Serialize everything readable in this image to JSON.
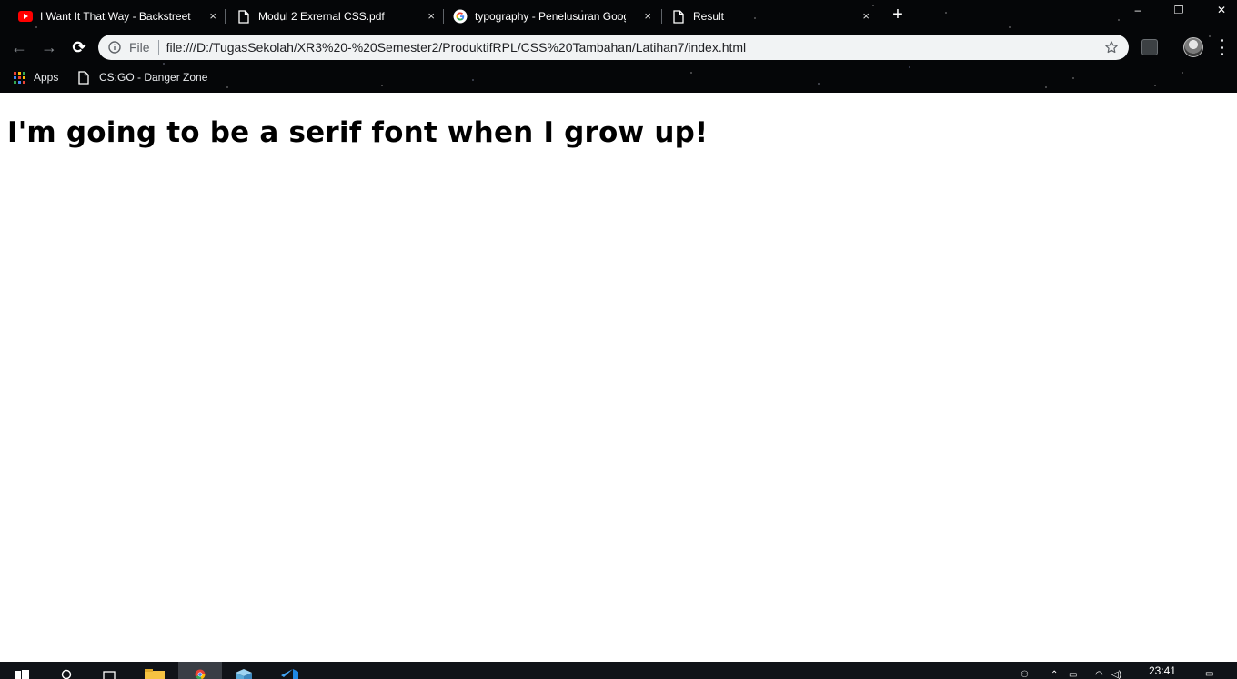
{
  "browser": {
    "tabs": [
      {
        "title": "I Want It That Way - Backstreet B",
        "icon": "youtube-icon",
        "close": "×"
      },
      {
        "title": "Modul 2 Exrernal CSS.pdf",
        "icon": "file-icon",
        "close": "×"
      },
      {
        "title": "typography - Penelusuran Googl",
        "icon": "google-icon",
        "close": "×"
      },
      {
        "title": "Result",
        "icon": "file-icon",
        "close": "×",
        "active": true
      }
    ],
    "new_tab_label": "+",
    "window_controls": {
      "minimize": "–",
      "restore": "❐",
      "close": "✕"
    },
    "toolbar": {
      "back": "←",
      "forward": "→",
      "reload": "⟳"
    },
    "omnibox": {
      "scheme_label": "File",
      "url": "file:///D:/TugasSekolah/XR3%20-%20Semester2/ProduktifRPL/CSS%20Tambahan/Latihan7/index.html"
    },
    "bookmarks": [
      {
        "label": "Apps",
        "icon": "apps-grid-icon"
      },
      {
        "label": "CS:GO - Danger Zone",
        "icon": "file-icon"
      }
    ]
  },
  "page": {
    "heading": "I'm going to be a serif font when I grow up!"
  },
  "taskbar": {
    "clock": "23:41"
  },
  "colors": {
    "frame_background": "#050608",
    "omnibox_background": "#f1f3f4",
    "youtube_red": "#ff0000",
    "page_background": "#ffffff",
    "heading_text": "#000000",
    "taskbar_background": "#101318"
  }
}
